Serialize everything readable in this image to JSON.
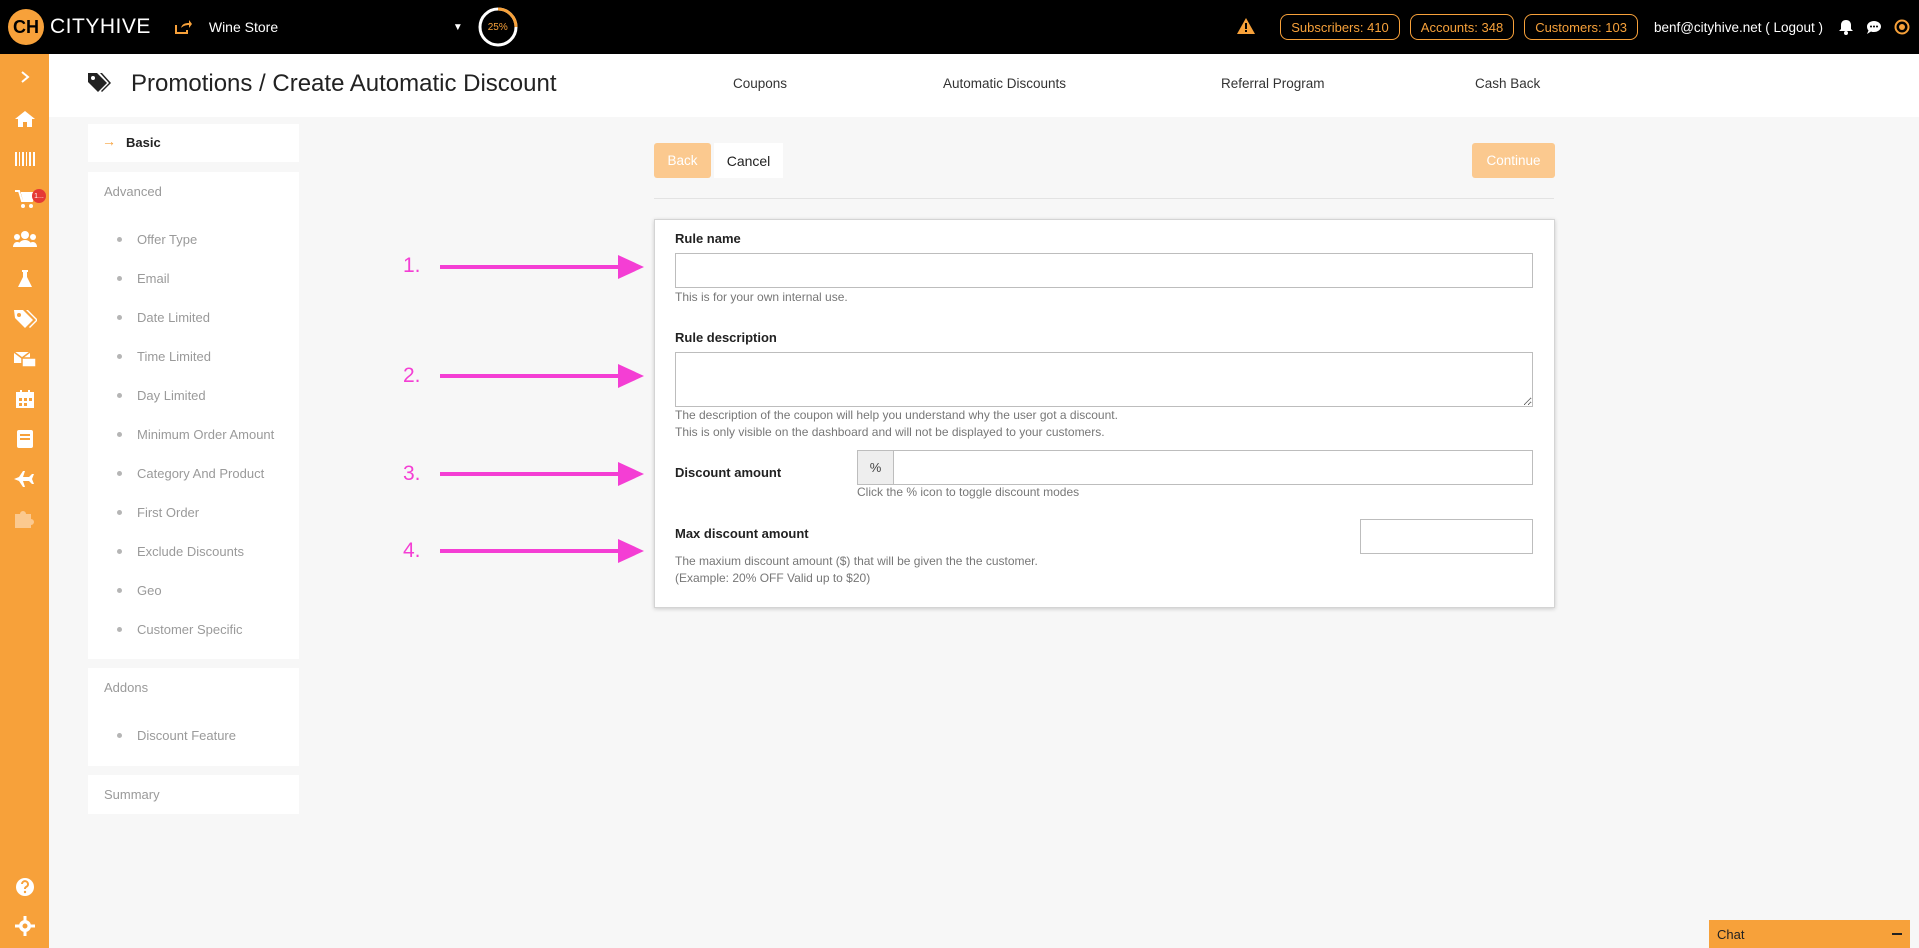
{
  "topbar": {
    "logo_text": "CITYHIVE",
    "logo_mark": "CH",
    "store_name": "Wine Store",
    "progress_pct": "25%",
    "progress_value": 25,
    "subscribers": "Subscribers: 410",
    "accounts": "Accounts: 348",
    "customers": "Customers: 103",
    "user": "benf@cityhive.net ( Logout )"
  },
  "rail": {
    "cart_badge": "1..."
  },
  "header": {
    "title": "Promotions / Create Automatic Discount",
    "nav": [
      "Coupons",
      "Automatic Discounts",
      "Referral Program",
      "Cash Back"
    ]
  },
  "steps": {
    "basic": "Basic",
    "advanced": "Advanced",
    "advanced_items": [
      "Offer Type",
      "Email",
      "Date Limited",
      "Time Limited",
      "Day Limited",
      "Minimum Order Amount",
      "Category And Product",
      "First Order",
      "Exclude Discounts",
      "Geo",
      "Customer Specific"
    ],
    "addons": "Addons",
    "addons_items": [
      "Discount Feature"
    ],
    "summary": "Summary"
  },
  "buttons": {
    "back": "Back",
    "cancel": "Cancel",
    "continue": "Continue"
  },
  "form": {
    "rule_name_label": "Rule name",
    "rule_name_value": "",
    "rule_name_help": "This is for your own internal use.",
    "rule_desc_label": "Rule description",
    "rule_desc_value": "",
    "rule_desc_help_1": "The description of the coupon will help you understand why the user got a discount.",
    "rule_desc_help_2": "This is only visible on the dashboard and will not be displayed to your customers.",
    "discount_label": "Discount amount",
    "discount_addon": "%",
    "discount_value": "",
    "discount_help": "Click the % icon to toggle discount modes",
    "max_label": "Max discount amount",
    "max_value": "",
    "max_help_1": "The maxium discount amount ($) that will be given the the customer.",
    "max_help_2": "(Example: 20% OFF Valid up to $20)"
  },
  "annotations": [
    "1.",
    "2.",
    "3.",
    "4."
  ],
  "chat": {
    "label": "Chat"
  },
  "colors": {
    "brand": "#f7a13a",
    "annotation": "#f43ed4",
    "disabled_button": "#fbc98f"
  }
}
